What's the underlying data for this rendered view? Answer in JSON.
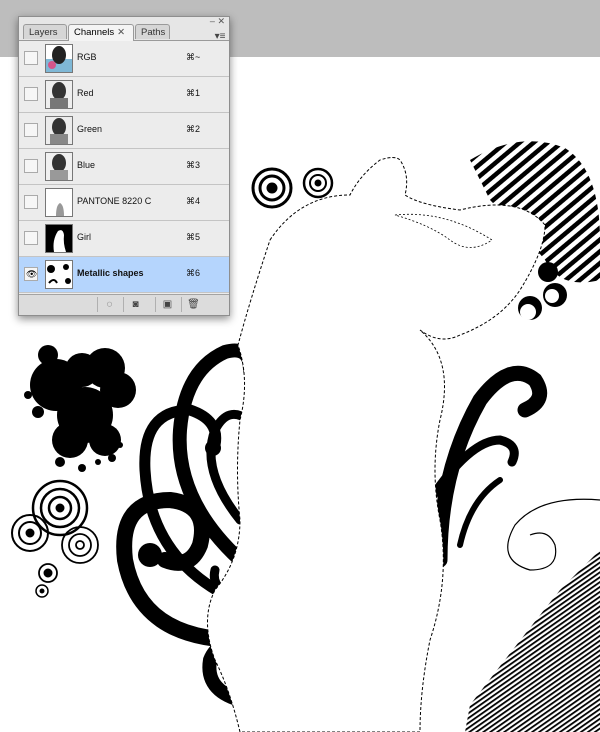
{
  "panel": {
    "tabs": [
      {
        "label": "Layers"
      },
      {
        "label": "Channels"
      },
      {
        "label": "Paths"
      }
    ],
    "channels": [
      {
        "name": "RGB",
        "shortcut": "⌘~",
        "visible": false,
        "selected": false
      },
      {
        "name": "Red",
        "shortcut": "⌘1",
        "visible": false,
        "selected": false
      },
      {
        "name": "Green",
        "shortcut": "⌘2",
        "visible": false,
        "selected": false
      },
      {
        "name": "Blue",
        "shortcut": "⌘3",
        "visible": false,
        "selected": false
      },
      {
        "name": "PANTONE 8220 C",
        "shortcut": "⌘4",
        "visible": false,
        "selected": false
      },
      {
        "name": "Girl",
        "shortcut": "⌘5",
        "visible": false,
        "selected": false
      },
      {
        "name": "Metallic shapes",
        "shortcut": "⌘6",
        "visible": true,
        "selected": true
      }
    ],
    "bottom_buttons": [
      "load-selection-icon",
      "save-selection-mask-icon",
      "new-channel-icon",
      "trash-icon"
    ]
  },
  "colors": {
    "selected_row": "#b5d5fd",
    "top_band": "#bdbdbd",
    "ink": "#000000"
  }
}
